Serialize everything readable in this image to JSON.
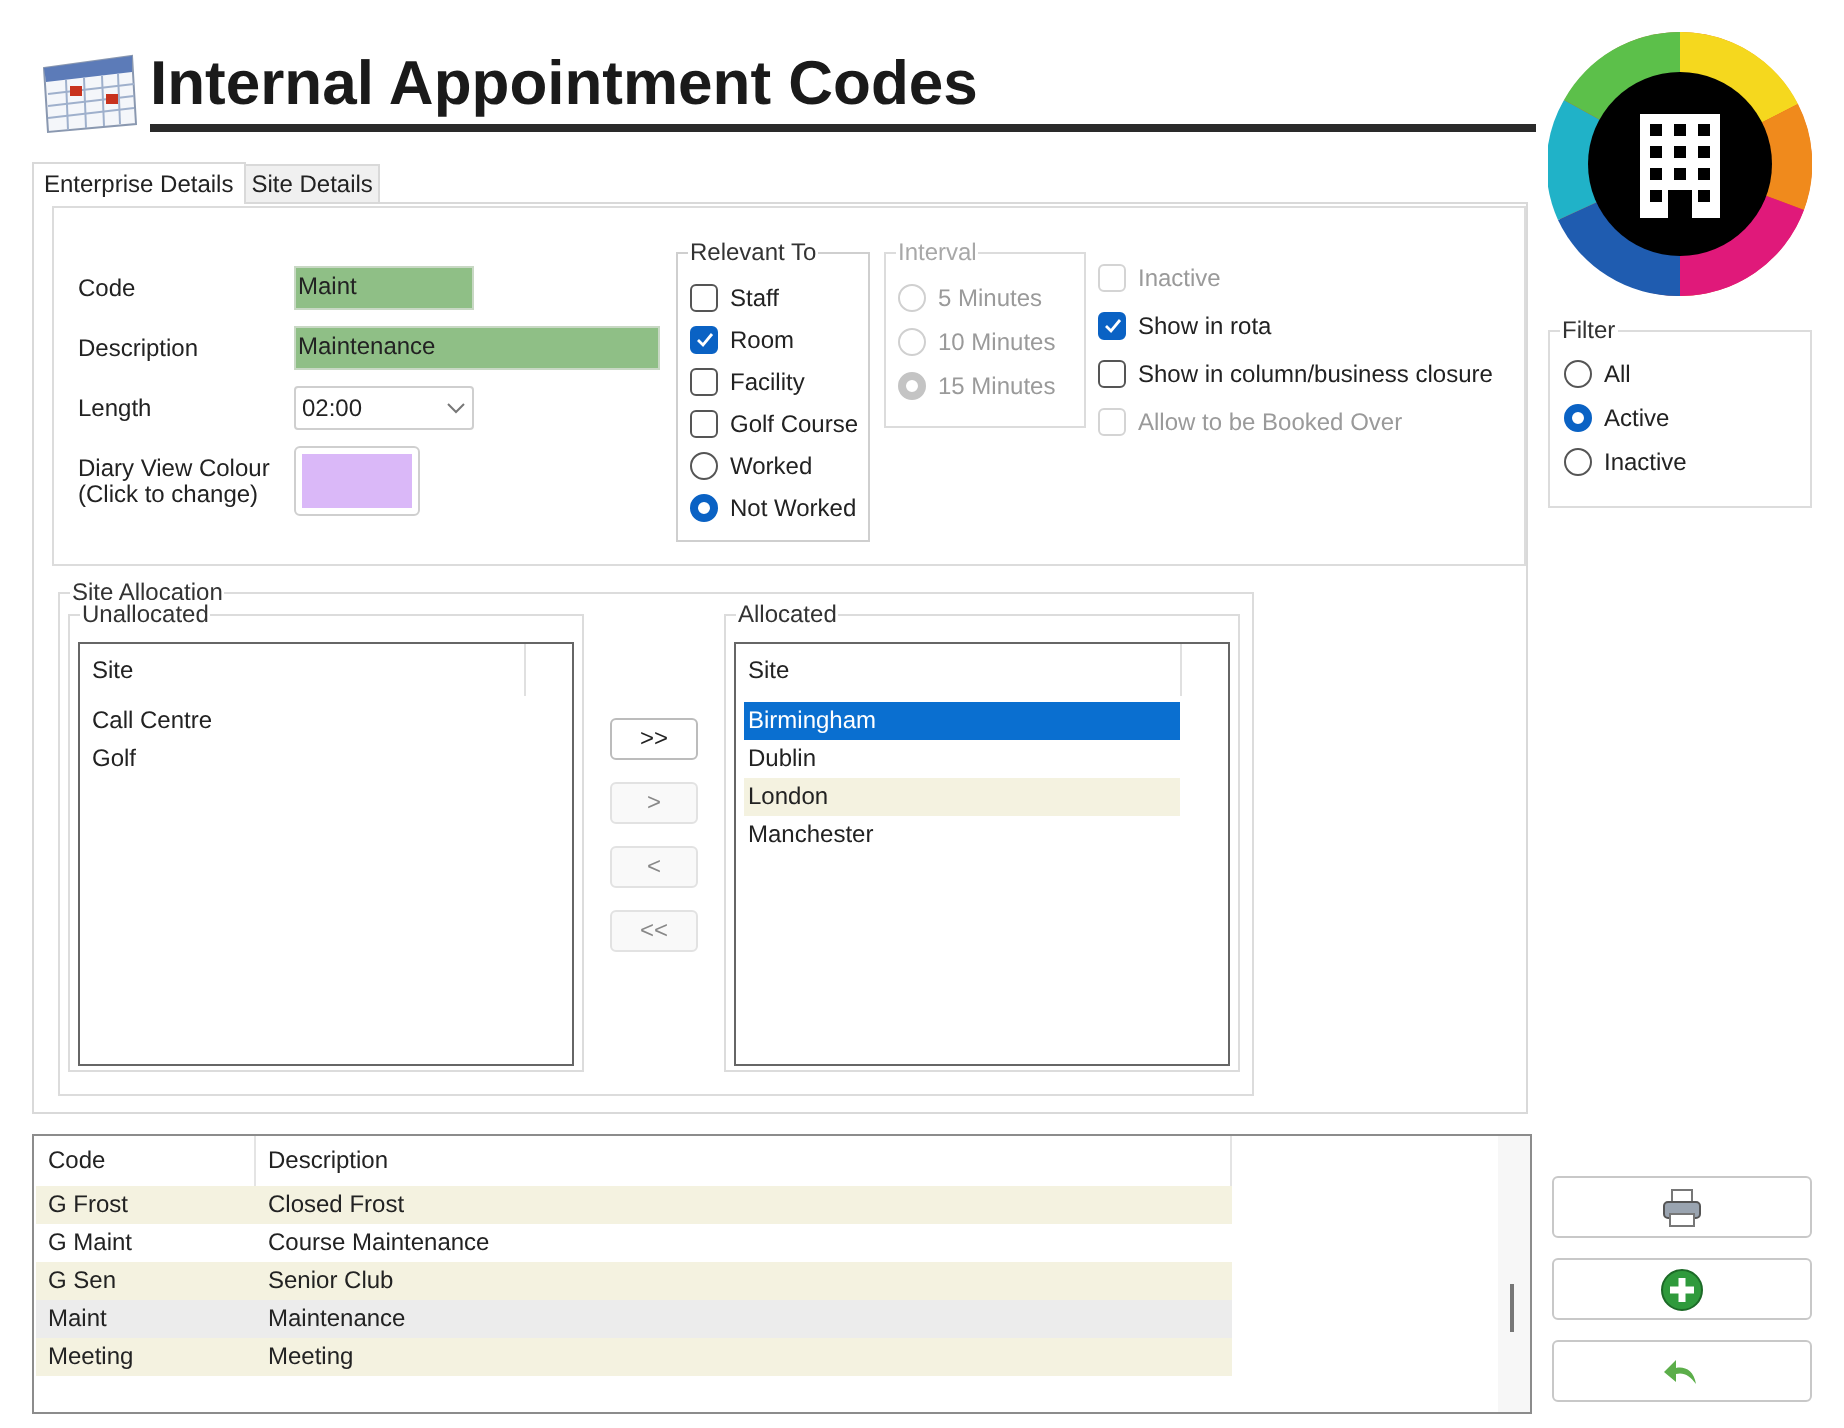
{
  "title": "Internal Appointment Codes",
  "tabs": [
    {
      "label": "Enterprise Details",
      "selected": true
    },
    {
      "label": "Site Details",
      "selected": false
    }
  ],
  "fields": [
    {
      "kind": "text",
      "label": "Code",
      "value": "Maint"
    },
    {
      "kind": "text",
      "label": "Description",
      "value": "Maintenance"
    },
    {
      "kind": "dropdown",
      "label": "Length",
      "value": "02:00"
    },
    {
      "kind": "color",
      "label": "Diary View Colour\n(Click to change)",
      "color": "#dab8f8"
    }
  ],
  "relevant_to": {
    "title": "Relevant To",
    "options": [
      {
        "kind": "checkbox",
        "label": "Staff",
        "checked": false
      },
      {
        "kind": "checkbox",
        "label": "Room",
        "checked": true
      },
      {
        "kind": "checkbox",
        "label": "Facility",
        "checked": false
      },
      {
        "kind": "checkbox",
        "label": "Golf Course",
        "checked": false
      },
      {
        "kind": "radio",
        "label": "Worked",
        "selected": false
      },
      {
        "kind": "radio",
        "label": "Not Worked",
        "selected": true
      }
    ]
  },
  "interval": {
    "title": "Interval",
    "disabled": true,
    "options": [
      {
        "label": "5 Minutes",
        "selected": false
      },
      {
        "label": "10 Minutes",
        "selected": false
      },
      {
        "label": "15 Minutes",
        "selected": true
      }
    ]
  },
  "flags": [
    {
      "label": "Inactive",
      "checked": false,
      "disabled": true
    },
    {
      "label": "Show in rota",
      "checked": true,
      "disabled": false
    },
    {
      "label": "Show in column/business closure",
      "checked": false,
      "disabled": false
    },
    {
      "label": "Allow to be Booked Over",
      "checked": false,
      "disabled": true
    }
  ],
  "site_allocation": {
    "title": "Site Allocation",
    "unallocated": {
      "title": "Unallocated",
      "column": "Site",
      "rows": [
        {
          "label": "Call Centre",
          "selected": false,
          "shaded": false
        },
        {
          "label": "Golf",
          "selected": false,
          "shaded": false
        }
      ]
    },
    "buttons": [
      {
        "label": ">>",
        "disabled": false
      },
      {
        "label": ">",
        "disabled": true
      },
      {
        "label": "<",
        "disabled": true
      },
      {
        "label": "<<",
        "disabled": true
      }
    ],
    "allocated": {
      "title": "Allocated",
      "column": "Site",
      "rows": [
        {
          "label": "Birmingham",
          "selected": true
        },
        {
          "label": "Dublin",
          "selected": false,
          "shaded": false
        },
        {
          "label": "London",
          "selected": false,
          "shaded": true
        },
        {
          "label": "Manchester",
          "selected": false,
          "shaded": false
        }
      ]
    }
  },
  "filter": {
    "title": "Filter",
    "options": [
      {
        "label": "All",
        "selected": false
      },
      {
        "label": "Active",
        "selected": true
      },
      {
        "label": "Inactive",
        "selected": false
      }
    ]
  },
  "codes_table": {
    "columns": [
      "Code",
      "Description"
    ],
    "rows": [
      {
        "cells": [
          "G Frost",
          "Closed Frost"
        ],
        "selected": false,
        "shaded": true
      },
      {
        "cells": [
          "G Maint",
          "Course Maintenance"
        ],
        "selected": false,
        "shaded": false
      },
      {
        "cells": [
          "G Sen",
          "Senior Club"
        ],
        "selected": false,
        "shaded": true
      },
      {
        "cells": [
          "Maint",
          "Maintenance"
        ],
        "selected": true
      },
      {
        "cells": [
          "Meeting",
          "Meeting"
        ],
        "selected": false,
        "shaded": true
      }
    ]
  },
  "actions": [
    {
      "kind": "print"
    },
    {
      "kind": "add"
    },
    {
      "kind": "undo"
    }
  ]
}
